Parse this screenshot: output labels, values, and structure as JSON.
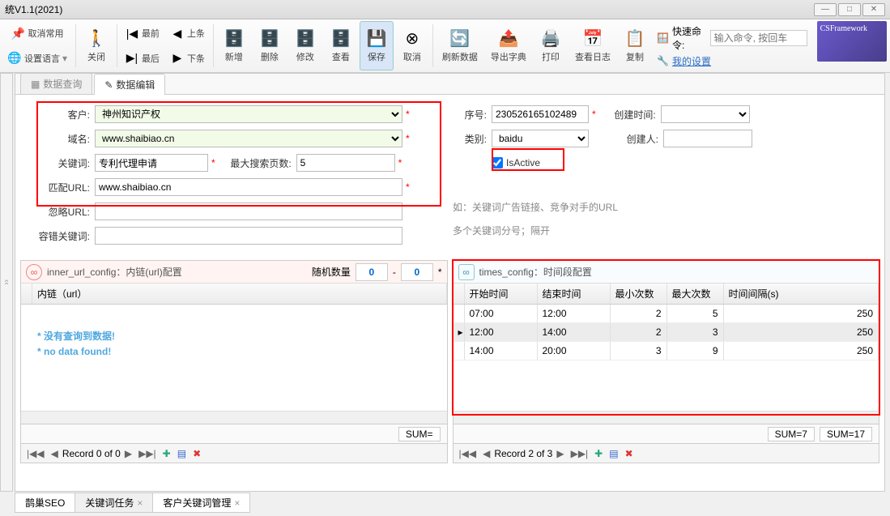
{
  "window": {
    "title": "统V1.1(2021)"
  },
  "ribbon": {
    "cancelCommon": "取消常用",
    "setLang": "设置语言",
    "close": "关闭",
    "first": "最前",
    "last": "最后",
    "prev": "上条",
    "next": "下条",
    "add": "新增",
    "del": "删除",
    "edit": "修改",
    "view": "查看",
    "save": "保存",
    "cancel": "取消",
    "refresh": "刷新数据",
    "exportDict": "导出字典",
    "print": "打印",
    "viewLog": "查看日志",
    "copy": "复制",
    "quickCmd": "快速命令:",
    "quickPlaceholder": "输入命令, 按回车",
    "mySettings": "我的设置",
    "logo": "CSFramework"
  },
  "tabs": {
    "query": "数据查询",
    "edit": "数据编辑"
  },
  "form": {
    "customer": "客户:",
    "customerVal": "神州知识产权",
    "domain": "域名:",
    "domainVal": "www.shaibiao.cn",
    "keyword": "关键词:",
    "keywordVal": "专利代理申请",
    "maxPages": "最大搜索页数:",
    "maxPagesVal": "5",
    "matchUrl": "匹配URL:",
    "matchUrlVal": "www.shaibiao.cn",
    "ignoreUrl": "忽略URL:",
    "ignoreUrlVal": "",
    "tolKeyword": "容错关键词:",
    "tolKeywordVal": "",
    "serial": "序号:",
    "serialVal": "230526165102489",
    "category": "类别:",
    "categoryVal": "baidu",
    "isActive": "IsActive",
    "createTime": "创建时间:",
    "createTimeVal": "",
    "creator": "创建人:",
    "creatorVal": "",
    "hint1": "如：关键词广告链接、竞争对手的URL",
    "hint2": "多个关键词分号；隔开"
  },
  "innerPane": {
    "title": "inner_url_config：内链(url)配置",
    "randLabel": "随机数量",
    "randFrom": "0",
    "randTo": "0",
    "col1": "内链（url）",
    "noData1": "* 没有查询到数据!",
    "noData2": "* no data found!",
    "sum": "SUM=",
    "record": "Record 0 of 0"
  },
  "timesPane": {
    "title": "times_config：时间段配置",
    "cols": [
      "开始时间",
      "结束时间",
      "最小次数",
      "最大次数",
      "时间间隔(s)"
    ],
    "rows": [
      {
        "start": "07:00",
        "end": "12:00",
        "min": "2",
        "max": "5",
        "iv": "250"
      },
      {
        "start": "12:00",
        "end": "14:00",
        "min": "2",
        "max": "3",
        "iv": "250"
      },
      {
        "start": "14:00",
        "end": "20:00",
        "min": "3",
        "max": "9",
        "iv": "250"
      }
    ],
    "sum1": "SUM=7",
    "sum2": "SUM=17",
    "record": "Record 2 of 3"
  },
  "bottomTabs": {
    "t1": "鹊巢SEO",
    "t2": "关键词任务",
    "t3": "客户关键词管理"
  }
}
